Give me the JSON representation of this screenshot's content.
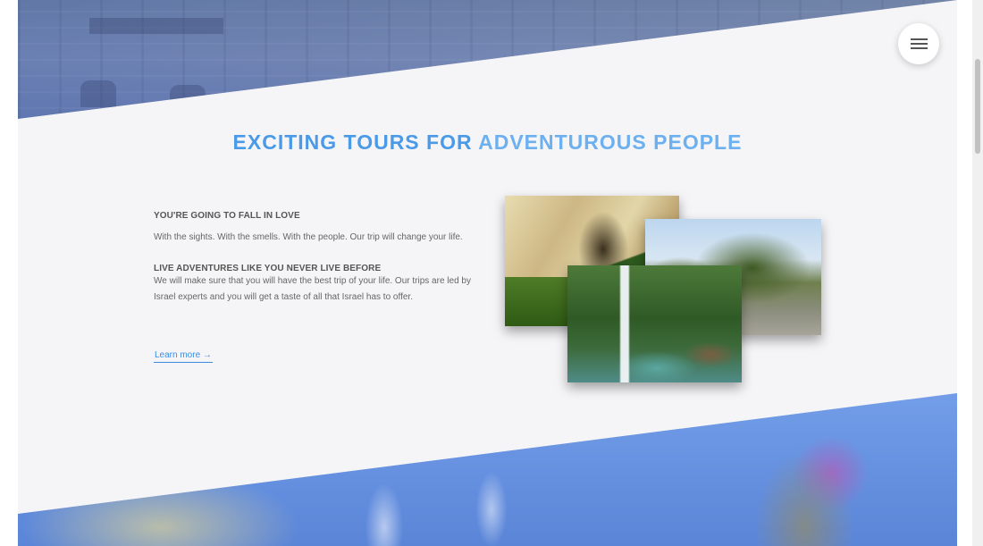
{
  "hero": {
    "heading_part1": "EXCITING TOURS FOR ",
    "heading_part2": "ADVENTUROUS PEOPLE"
  },
  "features": [
    {
      "title": "YOU'RE GOING TO FALL IN LOVE",
      "text": "With the sights. With the smells. With the people. Our trip will change your life."
    },
    {
      "title": "LIVE ADVENTURES LIKE YOU NEVER LIVE BEFORE",
      "text": "We will make sure that you will have the best trip of your life. Our trips are led by Israel experts and you will get a taste of all that Israel has to offer."
    }
  ],
  "cta": {
    "learn_more": "Learn more →"
  },
  "colors": {
    "accent": "#4a9ae8",
    "background": "#f5f5f7",
    "text": "#555555"
  },
  "icons": {
    "menu": "hamburger-menu-icon"
  }
}
